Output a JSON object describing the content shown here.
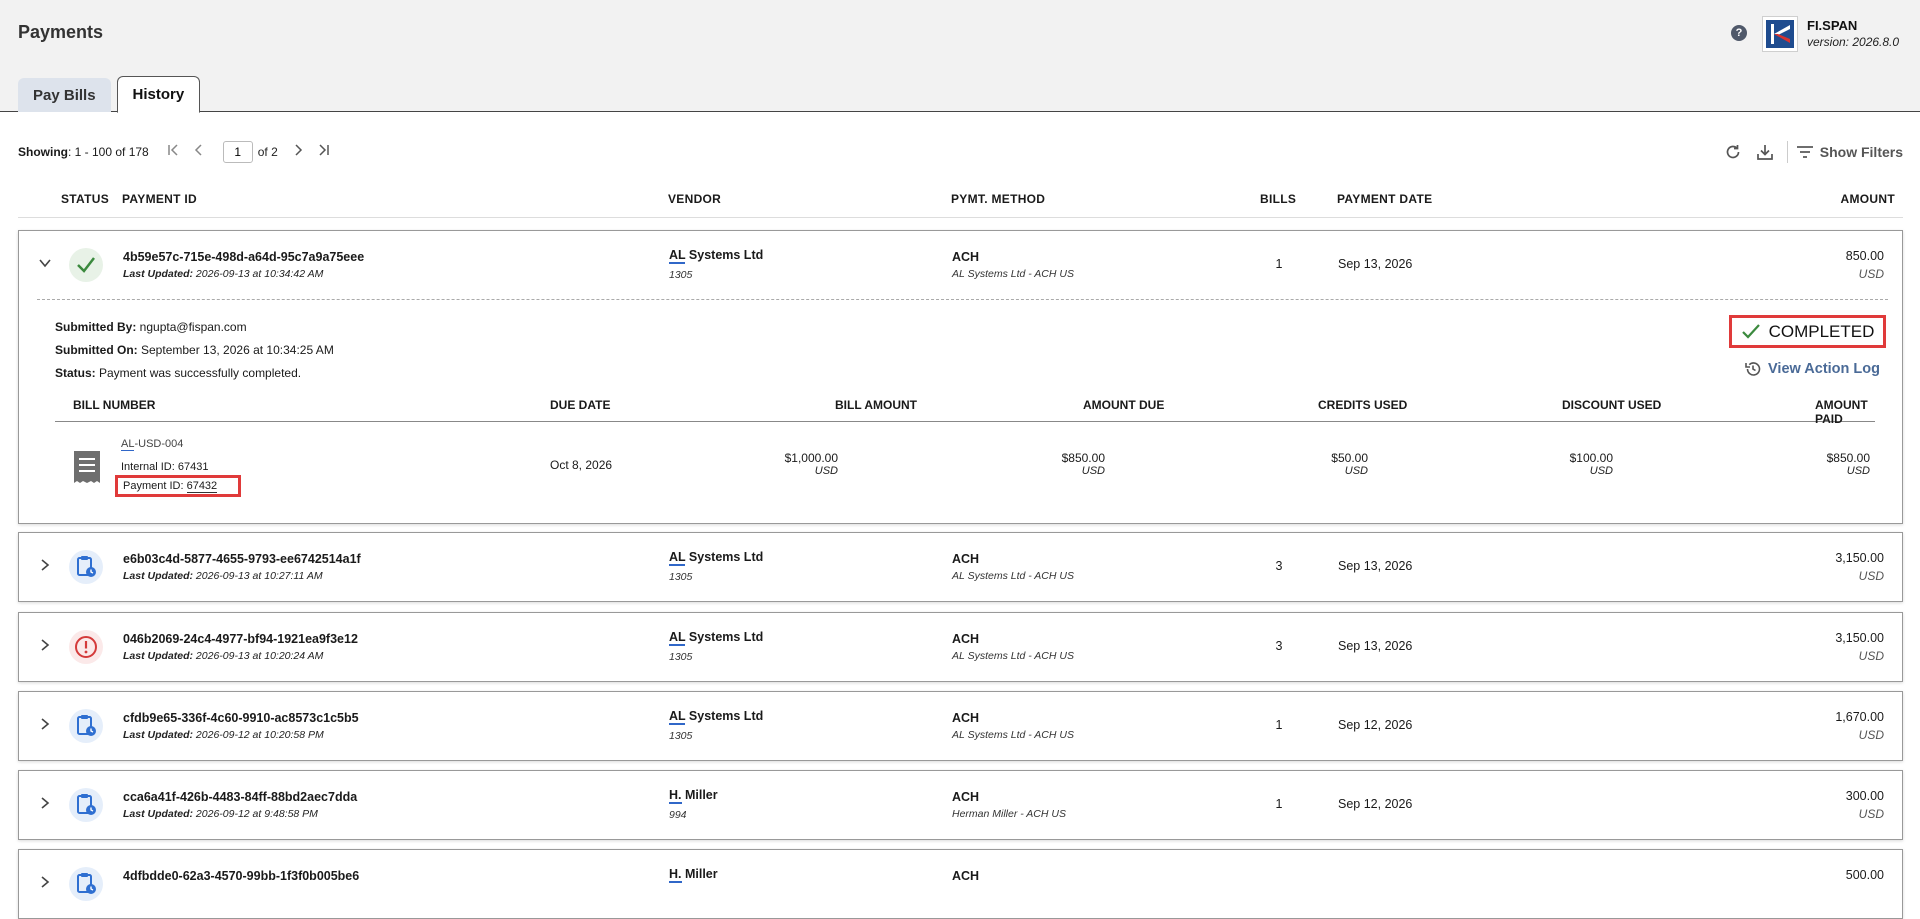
{
  "header": {
    "title": "Payments",
    "help": "?",
    "brand_name": "FI.SPAN",
    "brand_version": "version: 2026.8.0"
  },
  "tabs": [
    {
      "label": "Pay Bills",
      "active": false
    },
    {
      "label": "History",
      "active": true
    }
  ],
  "toolbar": {
    "showing_label": "Showing",
    "showing_value": ": 1 - 100 of 178",
    "page": "1",
    "of_pages": "of 2",
    "show_filters": "Show Filters"
  },
  "columns": {
    "status": "STATUS",
    "payment_id": "PAYMENT ID",
    "vendor": "VENDOR",
    "method": "PYMT. METHOD",
    "bills": "BILLS",
    "payment_date": "PAYMENT DATE",
    "amount": "AMOUNT"
  },
  "rows": [
    {
      "status": "completed",
      "id": "4b59e57c-715e-498d-a64d-95c7a9a75eee",
      "updated_label": "Last Updated:",
      "updated": " 2026-09-13 at 10:34:42 AM",
      "vendor_abbr": "AL",
      "vendor_rest": " Systems Ltd",
      "vendor_id": "1305",
      "method": "ACH",
      "method_account": "AL Systems Ltd - ACH US",
      "bills": "1",
      "date": "Sep 13, 2026",
      "amount": "850.00",
      "currency": "USD"
    },
    {
      "status": "scheduled",
      "id": "e6b03c4d-5877-4655-9793-ee6742514a1f",
      "updated_label": "Last Updated:",
      "updated": " 2026-09-13 at 10:27:11 AM",
      "vendor_abbr": "AL",
      "vendor_rest": " Systems Ltd",
      "vendor_id": "1305",
      "method": "ACH",
      "method_account": "AL Systems Ltd - ACH US",
      "bills": "3",
      "date": "Sep 13, 2026",
      "amount": "3,150.00",
      "currency": "USD"
    },
    {
      "status": "error",
      "id": "046b2069-24c4-4977-bf94-1921ea9f3e12",
      "updated_label": "Last Updated:",
      "updated": " 2026-09-13 at 10:20:24 AM",
      "vendor_abbr": "AL",
      "vendor_rest": " Systems Ltd",
      "vendor_id": "1305",
      "method": "ACH",
      "method_account": "AL Systems Ltd - ACH US",
      "bills": "3",
      "date": "Sep 13, 2026",
      "amount": "3,150.00",
      "currency": "USD"
    },
    {
      "status": "scheduled",
      "id": "cfdb9e65-336f-4c60-9910-ac8573c1c5b5",
      "updated_label": "Last Updated:",
      "updated": " 2026-09-12 at 10:20:58 PM",
      "vendor_abbr": "AL",
      "vendor_rest": " Systems Ltd",
      "vendor_id": "1305",
      "method": "ACH",
      "method_account": "AL Systems Ltd - ACH US",
      "bills": "1",
      "date": "Sep 12, 2026",
      "amount": "1,670.00",
      "currency": "USD"
    },
    {
      "status": "scheduled",
      "id": "cca6a41f-426b-4483-84ff-88bd2aec7dda",
      "updated_label": "Last Updated:",
      "updated": " 2026-09-12 at 9:48:58 PM",
      "vendor_abbr": "H.",
      "vendor_rest": " Miller",
      "vendor_id": "994",
      "method": "ACH",
      "method_account": "Herman Miller - ACH US",
      "bills": "1",
      "date": "Sep 12, 2026",
      "amount": "300.00",
      "currency": "USD"
    },
    {
      "status": "scheduled",
      "id": "4dfbdde0-62a3-4570-99bb-1f3f0b005be6",
      "updated_label": "",
      "updated": "",
      "vendor_abbr": "H.",
      "vendor_rest": " Miller",
      "vendor_id": "",
      "method": "ACH",
      "method_account": "",
      "bills": "",
      "date": "",
      "amount": "500.00",
      "currency": ""
    }
  ],
  "expanded": {
    "submitted_by_label": "Submitted By:",
    "submitted_by": " ngupta@fispan.com",
    "submitted_on_label": "Submitted On:",
    "submitted_on": " September 13, 2026 at 10:34:25 AM",
    "status_label": "Status:",
    "status_text": " Payment was successfully completed.",
    "badge": "COMPLETED",
    "action_log": "View Action Log",
    "columns": {
      "bill_number": "BILL NUMBER",
      "due_date": "DUE DATE",
      "bill_amount": "BILL AMOUNT",
      "amount_due": "AMOUNT DUE",
      "credits_used": "CREDITS USED",
      "discount_used": "DISCOUNT USED",
      "amount_paid": "AMOUNT PAID"
    },
    "bill": {
      "number_abbr": "AL",
      "number_rest": "-USD-004",
      "internal_id": "Internal ID: 67431",
      "payment_id_label": "Payment ID: ",
      "payment_id": "67432",
      "due_date": "Oct 8, 2026",
      "bill_amount": "$1,000.00",
      "amount_due": "$850.00",
      "credits_used": "$50.00",
      "discount_used": "$100.00",
      "amount_paid": "$850.00",
      "currency": "USD"
    }
  },
  "colors": {
    "completed": "#3b8a3e",
    "scheduled": "#2f6fd1",
    "error": "#d43a3a",
    "highlight": "#e03a3a",
    "link": "#4a6a97"
  }
}
